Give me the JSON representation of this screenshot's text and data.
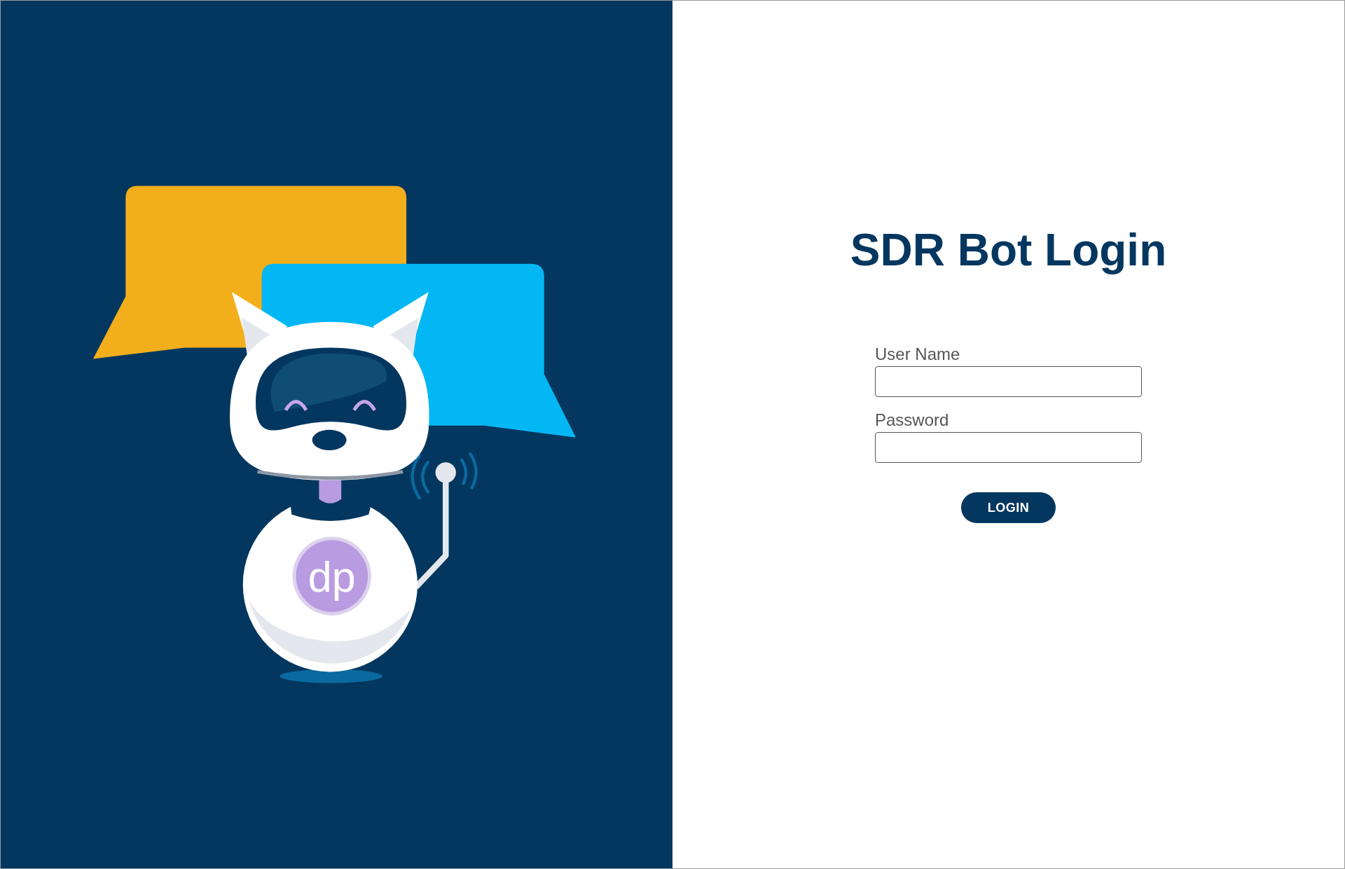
{
  "illustration": {
    "logo": "dp"
  },
  "title": "SDR Bot Login",
  "fields": [
    {
      "label": "User Name"
    },
    {
      "label": "Password"
    }
  ],
  "login_button": "LOGIN"
}
